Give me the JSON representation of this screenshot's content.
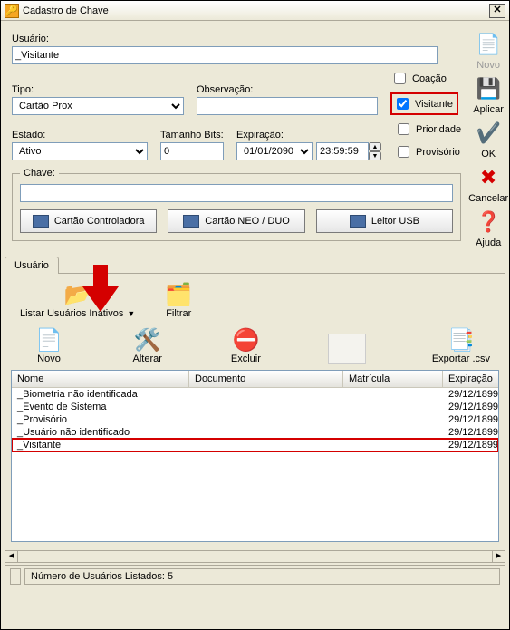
{
  "window": {
    "title": "Cadastro de Chave"
  },
  "form": {
    "usuario_label": "Usuário:",
    "usuario_value": "_Visitante",
    "tipo_label": "Tipo:",
    "tipo_value": "Cartão Prox",
    "observacao_label": "Observação:",
    "observacao_value": "",
    "estado_label": "Estado:",
    "estado_value": "Ativo",
    "tamanho_label": "Tamanho Bits:",
    "tamanho_value": "0",
    "expiracao_label": "Expiração:",
    "expiracao_date": "01/01/2090",
    "expiracao_time": "23:59:59",
    "chave_legend": "Chave:",
    "chave_value": ""
  },
  "checks": {
    "coacao": "Coação",
    "visitante": "Visitante",
    "prioridade": "Prioridade",
    "provisorio": "Provisório"
  },
  "buttons": {
    "cartao_controladora": "Cartão Controladora",
    "cartao_neo_duo": "Cartão NEO / DUO",
    "leitor_usb": "Leitor USB"
  },
  "sidebar": {
    "novo": "Novo",
    "aplicar": "Aplicar",
    "ok": "OK",
    "cancelar": "Cancelar",
    "ajuda": "Ajuda"
  },
  "tab": {
    "usuario": "Usuário"
  },
  "toolbar1": {
    "listar": "Listar Usuários Inativos",
    "filtrar": "Filtrar"
  },
  "toolbar2": {
    "novo": "Novo",
    "alterar": "Alterar",
    "excluir": "Excluir",
    "exportar": "Exportar .csv"
  },
  "columns": {
    "nome": "Nome",
    "documento": "Documento",
    "matricula": "Matrícula",
    "expiracao": "Expiração"
  },
  "rows": [
    {
      "nome": "_Biometria não identificada",
      "doc": "",
      "mat": "",
      "exp": "29/12/1899"
    },
    {
      "nome": "_Evento de Sistema",
      "doc": "",
      "mat": "",
      "exp": "29/12/1899"
    },
    {
      "nome": "_Provisório",
      "doc": "",
      "mat": "",
      "exp": "29/12/1899"
    },
    {
      "nome": "_Usuário não identificado",
      "doc": "",
      "mat": "",
      "exp": "29/12/1899"
    },
    {
      "nome": "_Visitante",
      "doc": "",
      "mat": "",
      "exp": "29/12/1899"
    }
  ],
  "status": {
    "count_label": "Número de Usuários Listados:  5"
  }
}
